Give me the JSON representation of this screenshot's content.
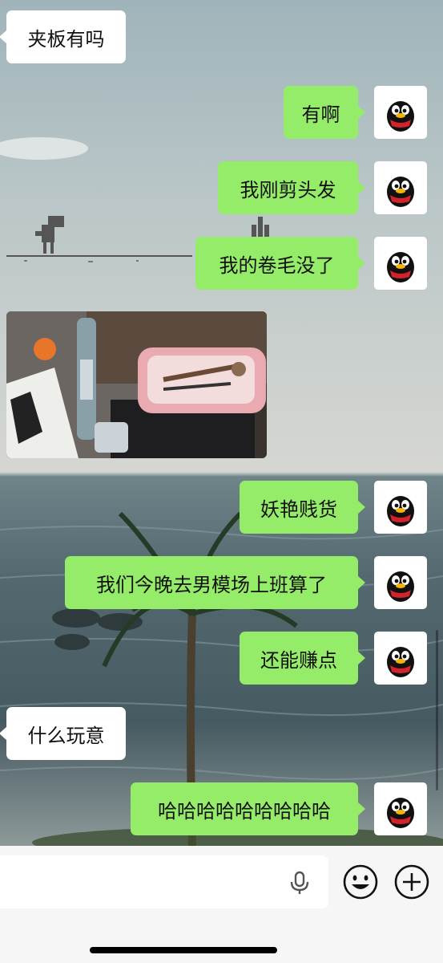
{
  "messages": [
    {
      "side": "in",
      "text": "夹板有吗"
    },
    {
      "side": "out",
      "text": "有啊"
    },
    {
      "side": "out",
      "text": "我刚剪头发"
    },
    {
      "side": "out",
      "text": "我的卷毛没了"
    },
    {
      "side": "out",
      "text": "妖艳贱货"
    },
    {
      "side": "out",
      "text": "我们今晚去男模场上班算了"
    },
    {
      "side": "out",
      "text": "还能赚点"
    },
    {
      "side": "in",
      "text": "什么玩意"
    },
    {
      "side": "out",
      "text": "哈哈哈哈哈哈哈哈哈"
    }
  ],
  "input": {
    "placeholder": ""
  },
  "colors": {
    "outgoing_bubble": "#95ec69",
    "incoming_bubble": "#ffffff",
    "input_bar": "#f6f6f6"
  },
  "icons": {
    "avatar": "penguin-avatar-icon",
    "voice": "microphone-icon",
    "emoji": "emoji-smile-icon",
    "more": "plus-circle-icon"
  }
}
